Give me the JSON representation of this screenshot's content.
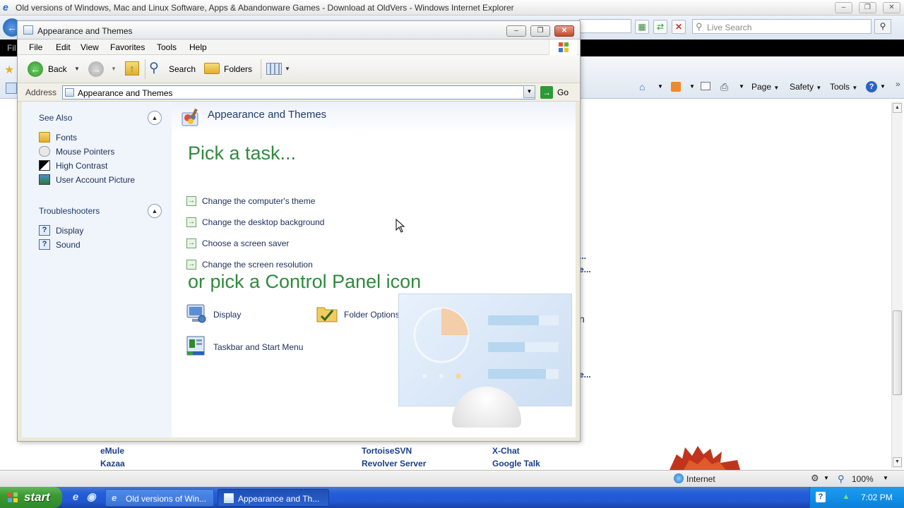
{
  "ie": {
    "title": "Old versions of Windows, Mac and Linux Software, Apps & Abandonware Games - Download at OldVers - Windows Internet Explorer",
    "search_placeholder": "Live Search",
    "menu_stub": "Fil",
    "commands": {
      "page": "Page",
      "safety": "Safety",
      "tools": "Tools"
    },
    "status_zone": "Internet",
    "zoom": "100%",
    "page_links": {
      "emule": "eMule",
      "kazaa": "Kazaa",
      "tortoise": "TortoiseSVN",
      "revolver": "Revolver Server",
      "xchat": "X-Chat",
      "gtalk": "Google Talk",
      "ell1": "...",
      "ell2": "e...",
      "frag_n": "n",
      "ell3": "e..."
    }
  },
  "explorer": {
    "title": "Appearance and Themes",
    "menu": [
      "File",
      "Edit",
      "View",
      "Favorites",
      "Tools",
      "Help"
    ],
    "toolbar": {
      "back": "Back",
      "search": "Search",
      "folders": "Folders"
    },
    "address_label": "Address",
    "address_value": "Appearance and Themes",
    "go_label": "Go",
    "see_also": {
      "heading": "See Also",
      "items": [
        "Fonts",
        "Mouse Pointers",
        "High Contrast",
        "User Account Picture"
      ]
    },
    "troubleshooters": {
      "heading": "Troubleshooters",
      "items": [
        "Display",
        "Sound"
      ]
    },
    "content": {
      "header": "Appearance and Themes",
      "pick_task": "Pick a task...",
      "tasks": [
        "Change the computer's theme",
        "Change the desktop background",
        "Choose a screen saver",
        "Change the screen resolution"
      ],
      "pick_icon": "or pick a Control Panel icon",
      "icons": [
        "Display",
        "Folder Options",
        "Taskbar and Start Menu"
      ]
    }
  },
  "taskbar": {
    "start": "start",
    "tasks": [
      "Old versions of Win...",
      "Appearance and Th..."
    ],
    "clock": "7:02 PM"
  }
}
